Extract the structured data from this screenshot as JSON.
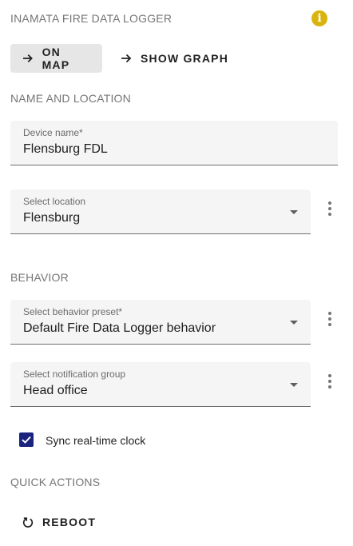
{
  "header": {
    "title": "INAMATA FIRE DATA LOGGER",
    "info_icon": "info-icon",
    "info_color": "#d8b40c"
  },
  "actions": {
    "on_map_label": "ON MAP",
    "show_graph_label": "SHOW GRAPH",
    "arrow_icon": "arrow-right-icon"
  },
  "name_location": {
    "title": "NAME AND LOCATION",
    "device_name_label": "Device name*",
    "device_name_value": "Flensburg FDL",
    "location_label": "Select location",
    "location_value": "Flensburg"
  },
  "behavior": {
    "title": "BEHAVIOR",
    "preset_label": "Select behavior preset*",
    "preset_value": "Default Fire Data Logger behavior",
    "notification_label": "Select notification group",
    "notification_value": "Head office",
    "sync_clock_label": "Sync real-time clock",
    "sync_clock_checked": true,
    "checkbox_color": "#1a237e"
  },
  "quick_actions": {
    "title": "QUICK ACTIONS",
    "reboot_label": "REBOOT",
    "reboot_icon": "restart-icon"
  }
}
